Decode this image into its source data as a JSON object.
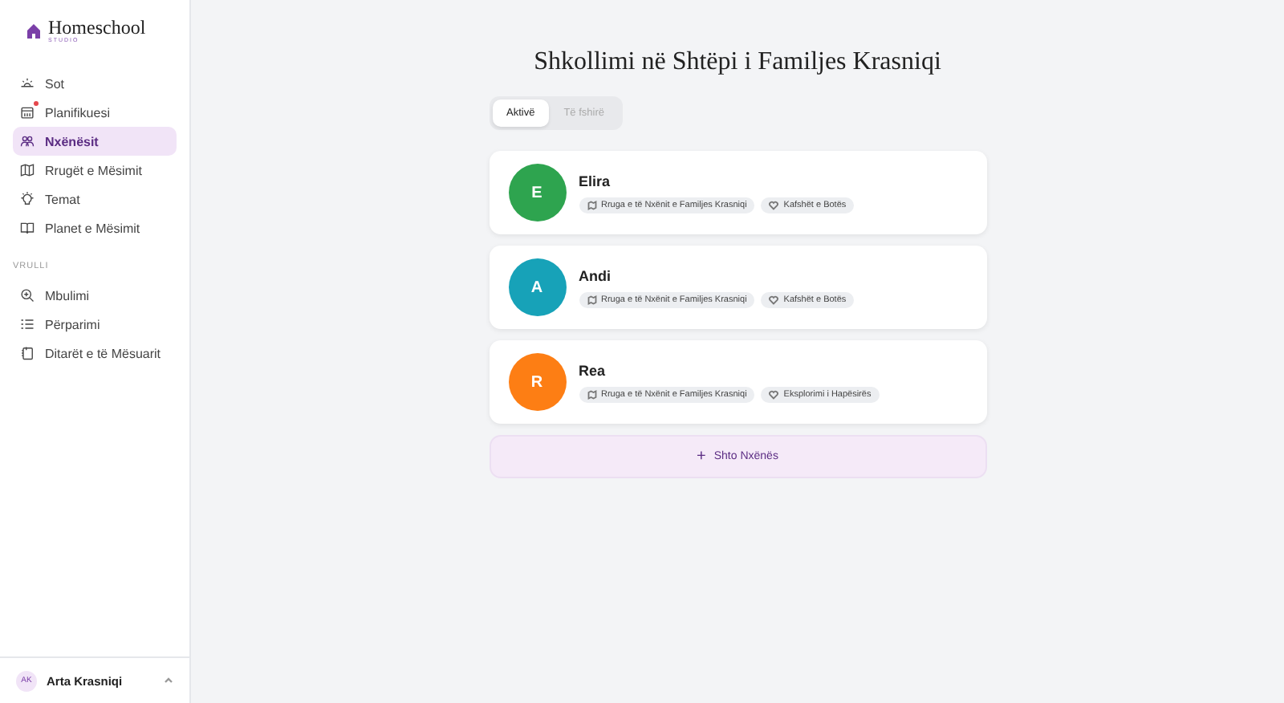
{
  "brand": {
    "name": "Homeschool",
    "subtitle": "STUDIO"
  },
  "nav": [
    {
      "label": "Sot",
      "kind": "sun",
      "selected": false,
      "notification": false
    },
    {
      "label": "Planifikuesi",
      "kind": "calendar",
      "selected": false,
      "notification": true
    },
    {
      "label": "Nxënësit",
      "kind": "people",
      "selected": true,
      "notification": false
    },
    {
      "label": "Rrugët e Mësimit",
      "kind": "map",
      "selected": false,
      "notification": false
    },
    {
      "label": "Temat",
      "kind": "bulb",
      "selected": false,
      "notification": false
    },
    {
      "label": "Planet e Mësimit",
      "kind": "book",
      "selected": false,
      "notification": false
    }
  ],
  "section_label": "VRULLI",
  "nav2": [
    {
      "label": "Mbulimi",
      "kind": "zoom",
      "selected": false,
      "notification": false
    },
    {
      "label": "Përparimi",
      "kind": "list",
      "selected": false,
      "notification": false
    },
    {
      "label": "Ditarët e të Mësuarit",
      "kind": "journal",
      "selected": false,
      "notification": false
    }
  ],
  "user": {
    "initials": "AK",
    "name": "Arta Krasniqi"
  },
  "title": "Shkollimi në Shtëpi i Familjes Krasniqi",
  "tabs": [
    {
      "label": "Aktivë",
      "selected": true
    },
    {
      "label": "Të fshirë",
      "selected": false
    }
  ],
  "students": [
    {
      "initial": "E",
      "name": "Elira",
      "color": "#2ea44f",
      "tags": [
        {
          "kind": "path",
          "label": "Rruga e të Nxënit e Familjes Krasniqi"
        },
        {
          "kind": "theme",
          "label": "Kafshët e Botës"
        }
      ]
    },
    {
      "initial": "A",
      "name": "Andi",
      "color": "#17a2b8",
      "tags": [
        {
          "kind": "path",
          "label": "Rruga e të Nxënit e Familjes Krasniqi"
        },
        {
          "kind": "theme",
          "label": "Kafshët e Botës"
        }
      ]
    },
    {
      "initial": "R",
      "name": "Rea",
      "color": "#fd7e14",
      "tags": [
        {
          "kind": "path",
          "label": "Rruga e të Nxënit e Familjes Krasniqi"
        },
        {
          "kind": "theme",
          "label": "Eksplorimi i Hapësirës"
        }
      ]
    }
  ],
  "add_button": {
    "icon": "+",
    "label": "Shto Nxënës"
  }
}
